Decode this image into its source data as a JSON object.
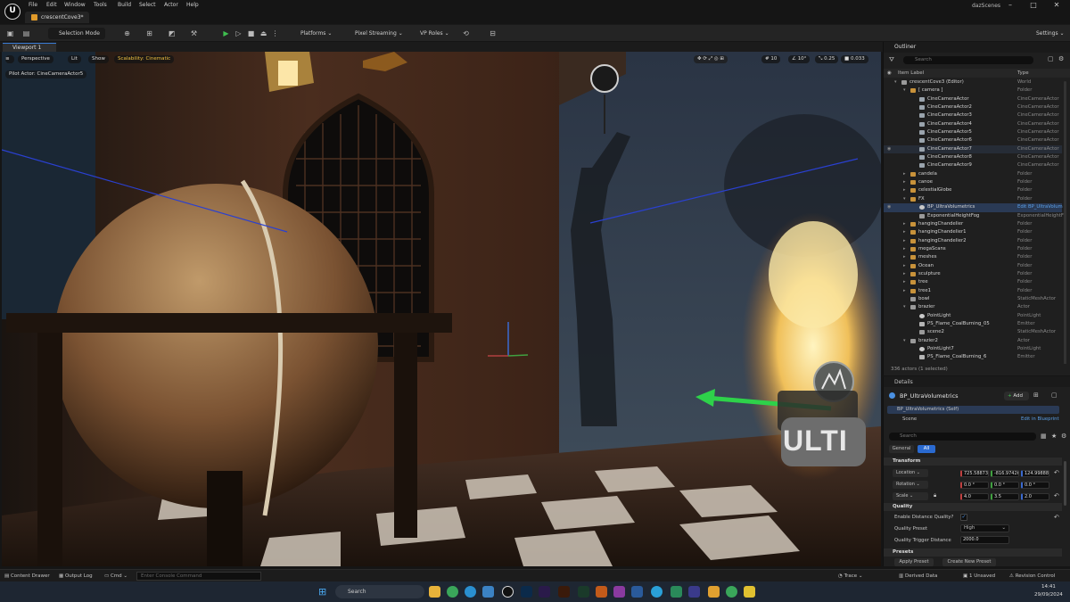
{
  "titlebar": {
    "menu": [
      "File",
      "Edit",
      "Window",
      "Tools",
      "Build",
      "Select",
      "Actor",
      "Help"
    ],
    "project_tab": "crescentCove3*",
    "window_title": "dazScenes",
    "logo": "U"
  },
  "toolbar": {
    "selection_mode": "Selection Mode",
    "platforms": "Platforms",
    "pixel_streaming": "Pixel Streaming",
    "vp_roles": "VP Roles",
    "settings": "Settings"
  },
  "viewport": {
    "tab": "Viewport 1",
    "perspective": "Perspective",
    "lit": "Lit",
    "show": "Show",
    "scalability": "Scalability: Cinematic",
    "pilot": "Pilot Actor: CineCameraActor5",
    "grid_snap": "10",
    "rot_snap": "10°",
    "scale_snap": "0.25",
    "cam_speed": "0.033",
    "overlay_text": "ULTI"
  },
  "outliner": {
    "tab": "Outliner",
    "search_placeholder": "Search",
    "col_label": "Item Label",
    "col_type": "Type",
    "footer": "336 actors (1 selected)",
    "rows": [
      {
        "label": "crescentCove3 (Editor)",
        "type": "World",
        "indent": 0,
        "icon": "world",
        "expanded": true
      },
      {
        "label": "[ camera ]",
        "type": "Folder",
        "indent": 1,
        "icon": "folder",
        "expanded": true
      },
      {
        "label": "CineCameraActor",
        "type": "CineCameraActor",
        "indent": 2,
        "icon": "cam"
      },
      {
        "label": "CineCameraActor2",
        "type": "CineCameraActor",
        "indent": 2,
        "icon": "cam"
      },
      {
        "label": "CineCameraActor3",
        "type": "CineCameraActor",
        "indent": 2,
        "icon": "cam"
      },
      {
        "label": "CineCameraActor4",
        "type": "CineCameraActor",
        "indent": 2,
        "icon": "cam"
      },
      {
        "label": "CineCameraActor5",
        "type": "CineCameraActor",
        "indent": 2,
        "icon": "cam"
      },
      {
        "label": "CineCameraActor6",
        "type": "CineCameraActor",
        "indent": 2,
        "icon": "cam"
      },
      {
        "label": "CineCameraActor7",
        "type": "CineCameraActor",
        "indent": 2,
        "icon": "cam",
        "hover": true
      },
      {
        "label": "CineCameraActor8",
        "type": "CineCameraActor",
        "indent": 2,
        "icon": "cam"
      },
      {
        "label": "CineCameraActor9",
        "type": "CineCameraActor",
        "indent": 2,
        "icon": "cam"
      },
      {
        "label": "candela",
        "type": "Folder",
        "indent": 1,
        "icon": "folder"
      },
      {
        "label": "canoe",
        "type": "Folder",
        "indent": 1,
        "icon": "folder"
      },
      {
        "label": "celestialGlobe",
        "type": "Folder",
        "indent": 1,
        "icon": "folder"
      },
      {
        "label": "FX",
        "type": "Folder",
        "indent": 1,
        "icon": "folder",
        "expanded": true
      },
      {
        "label": "BP_UltraVolumetrics",
        "type": "Edit BP_UltraVolum",
        "indent": 2,
        "icon": "light",
        "selected": true
      },
      {
        "label": "ExponentialHeightFog",
        "type": "ExponentialHeightF",
        "indent": 2,
        "icon": "mesh"
      },
      {
        "label": "hangingChandelier",
        "type": "Folder",
        "indent": 1,
        "icon": "folder"
      },
      {
        "label": "hangingChandelier1",
        "type": "Folder",
        "indent": 1,
        "icon": "folder"
      },
      {
        "label": "hangingChandelier2",
        "type": "Folder",
        "indent": 1,
        "icon": "folder"
      },
      {
        "label": "megaScans",
        "type": "Folder",
        "indent": 1,
        "icon": "folder"
      },
      {
        "label": "meshes",
        "type": "Folder",
        "indent": 1,
        "icon": "folder"
      },
      {
        "label": "Ocean",
        "type": "Folder",
        "indent": 1,
        "icon": "folder"
      },
      {
        "label": "sculpture",
        "type": "Folder",
        "indent": 1,
        "icon": "folder"
      },
      {
        "label": "tree",
        "type": "Folder",
        "indent": 1,
        "icon": "folder"
      },
      {
        "label": "tree1",
        "type": "Folder",
        "indent": 1,
        "icon": "folder"
      },
      {
        "label": "bowl",
        "type": "StaticMeshActor",
        "indent": 1,
        "icon": "mesh"
      },
      {
        "label": "brazier",
        "type": "Actor",
        "indent": 1,
        "icon": "mesh",
        "expanded": true
      },
      {
        "label": "PointLight",
        "type": "PointLight",
        "indent": 2,
        "icon": "light"
      },
      {
        "label": "PS_Flame_CoalBurning_05",
        "type": "Emitter",
        "indent": 2,
        "icon": "emit"
      },
      {
        "label": "scene2",
        "type": "StaticMeshActor",
        "indent": 2,
        "icon": "mesh"
      },
      {
        "label": "brazier2",
        "type": "Actor",
        "indent": 1,
        "icon": "mesh",
        "expanded": true
      },
      {
        "label": "PointLight7",
        "type": "PointLight",
        "indent": 2,
        "icon": "light"
      },
      {
        "label": "PS_Flame_CoalBurning_6",
        "type": "Emitter",
        "indent": 2,
        "icon": "emit"
      }
    ]
  },
  "details": {
    "tab": "Details",
    "actor_name": "BP_UltraVolumetrics",
    "add_label": "Add",
    "self_row": "BP_UltraVolumetrics (Self)",
    "scene_row": "Scene",
    "edit_in_blueprint": "Edit in Blueprint",
    "search_placeholder": "Search",
    "filter_general": "General",
    "filter_all": "All",
    "transform_header": "Transform",
    "location_label": "Location",
    "rotation_label": "Rotation",
    "scale_label": "Scale",
    "location": [
      "725.588730",
      "-816.97426",
      "124.99888"
    ],
    "rotation": [
      "0.0 °",
      "0.0 °",
      "0.0 °"
    ],
    "scale": [
      "4.0",
      "3.5",
      "2.0"
    ],
    "quality_header": "Quality",
    "enable_distance_quality": "Enable Distance Quality?",
    "quality_preset_label": "Quality Preset",
    "quality_preset_value": "High",
    "quality_trigger_label": "Quality Trigger Distance",
    "quality_trigger_value": "2000.0",
    "presets_header": "Presets",
    "apply_preset": "Apply Preset",
    "create_preset": "Create New Preset"
  },
  "statusbar": {
    "content_drawer": "Content Drawer",
    "output_log": "Output Log",
    "cmd": "Cmd",
    "console_placeholder": "Enter Console Command",
    "trace": "Trace",
    "derived_data": "Derived Data",
    "unsaved": "1 Unsaved",
    "revision_control": "Revision Control"
  },
  "taskbar": {
    "search_placeholder": "Search",
    "time": "14:41",
    "date": "29/09/2024"
  }
}
